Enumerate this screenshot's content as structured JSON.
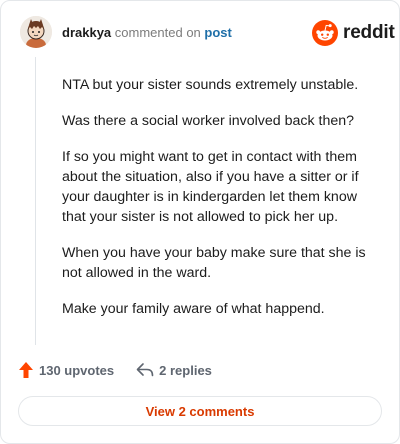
{
  "header": {
    "username": "drakkya",
    "commented_on": "commented on",
    "post_label": "post",
    "brand_wordmark": "reddit",
    "brand_icon": "reddit-snoo-icon",
    "avatar_icon": "avatar-icon"
  },
  "comment": {
    "paragraphs": [
      "NTA but your sister sounds extremely unstable.",
      "Was there a social worker involved back then?",
      "If so you might want to get in contact with them about the situation, also if you have a sitter or if your daughter is in kindergarden let them know that your sister is not allowed to pick her up.",
      "When you have your baby make sure that she is not allowed in the ward.",
      "Make your family aware of what happend."
    ]
  },
  "actions": {
    "upvotes_label": "130 upvotes",
    "upvote_icon": "upvote-arrow-icon",
    "replies_label": "2 replies",
    "reply_icon": "reply-arrow-icon",
    "view_comments_label": "View 2 comments"
  },
  "colors": {
    "brand": "#ff4500",
    "link": "#1f6fa8",
    "view_comments": "#d93a00"
  }
}
